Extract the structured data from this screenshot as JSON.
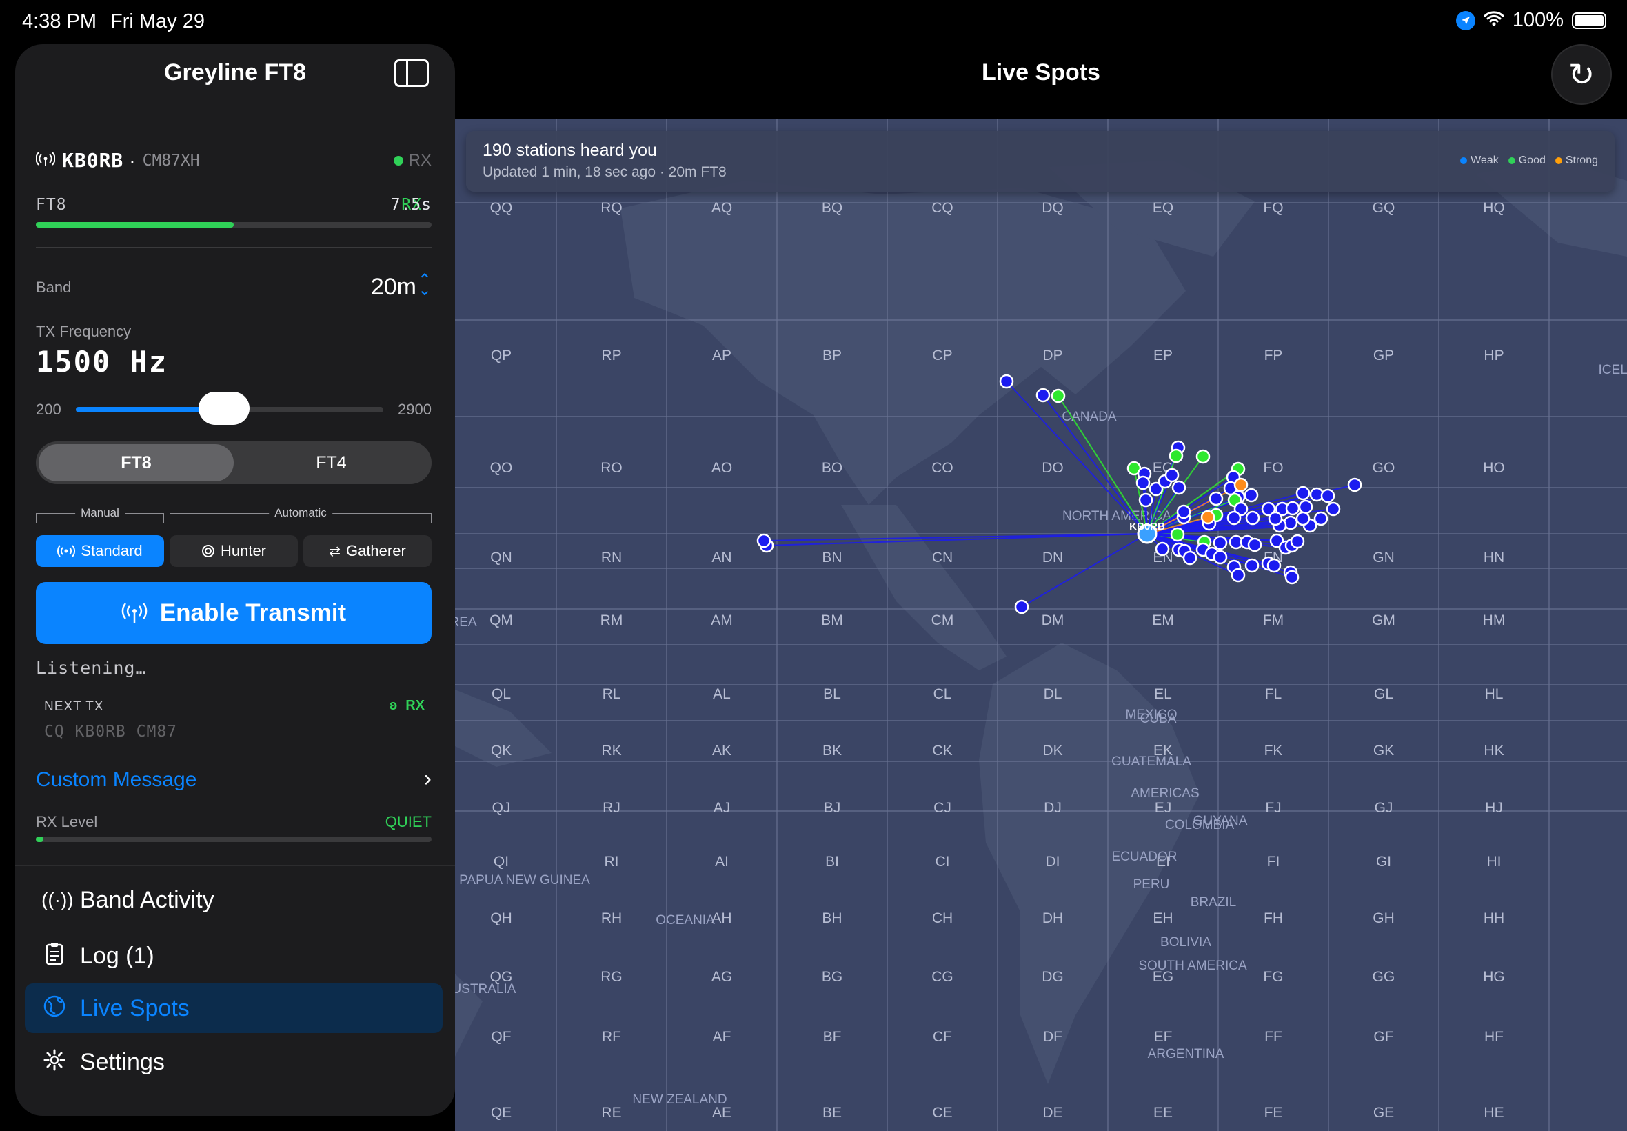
{
  "status": {
    "time": "4:38 PM",
    "date": "Fri May 29",
    "battery": "100%"
  },
  "sidebar": {
    "title": "Greyline FT8",
    "callsign": "KB0RB",
    "separator": "·",
    "grid": "CM87XH",
    "rx_state": "RX",
    "mode": "FT8",
    "cycle_state": "RX",
    "cycle_time": "7.5s",
    "cycle_progress": 0.5,
    "band_label": "Band",
    "band_value": "20m",
    "tx_freq_label": "TX Frequency",
    "tx_freq_value": "1500 Hz",
    "slider": {
      "min": "200",
      "max": "2900",
      "value": 1500,
      "min_value": 200,
      "max_value": 2900
    },
    "mode_tabs": [
      "FT8",
      "FT4"
    ],
    "selected_mode": "FT8",
    "group_manual": "Manual",
    "group_automatic": "Automatic",
    "op_modes": [
      "Standard",
      "Hunter",
      "Gatherer"
    ],
    "selected_op": "Standard",
    "enable_transmit": "Enable Transmit",
    "listening": "Listening…",
    "next_tx_label": "NEXT TX",
    "next_tx_state": "RX",
    "next_tx_message": "CQ KB0RB CM87",
    "custom_message": "Custom Message",
    "rx_level_label": "RX Level",
    "rx_level_value": "QUIET",
    "rx_level_fraction": 0.02,
    "nav": [
      {
        "label": "Band Activity",
        "icon": "antenna-icon"
      },
      {
        "label": "Log (1)",
        "icon": "clipboard-icon"
      },
      {
        "label": "Live Spots",
        "icon": "globe-icon"
      },
      {
        "label": "Settings",
        "icon": "gear-icon"
      }
    ],
    "selected_nav": "Live Spots"
  },
  "header": {
    "title": "Live Spots"
  },
  "banner": {
    "title": "190 stations heard you",
    "subtitle": "Updated 1 min, 18 sec ago · 20m FT8",
    "legend": [
      {
        "label": "Weak",
        "color": "#0a84ff"
      },
      {
        "label": "Good",
        "color": "#30d158"
      },
      {
        "label": "Strong",
        "color": "#ff9f0a"
      }
    ]
  },
  "map": {
    "home_label": "KB0RB",
    "columns": [
      "QQ",
      "RQ",
      "AQ",
      "BQ",
      "CQ",
      "DQ",
      "EQ",
      "FQ",
      "GQ",
      "HQ"
    ],
    "row_letters": [
      "P",
      "O",
      "N",
      "M",
      "L",
      "K",
      "J",
      "I",
      "H",
      "G",
      "F",
      "E"
    ],
    "col_letters": [
      "Q",
      "R",
      "A",
      "B",
      "C",
      "D",
      "E",
      "F",
      "G",
      "H"
    ],
    "place_labels": [
      "CANADA",
      "NORTH AMERICA",
      "MEXICO",
      "CUBA",
      "GUATEMALA",
      "AMERICAS",
      "COLOMBIA",
      "GUYANA",
      "ECUADOR",
      "PERU",
      "BRAZIL",
      "BOLIVIA",
      "SOUTH AMERICA",
      "ARGENTINA",
      "PAPUA NEW GUINEA",
      "OCEANIA",
      "NEW ZEALAND",
      "USTRALIA",
      "REA",
      "ICELA"
    ],
    "colors": {
      "weak": "#1b1bf0",
      "good": "#2ee82e",
      "strong": "#ff8c1a",
      "home": "#3aa0ff"
    }
  }
}
